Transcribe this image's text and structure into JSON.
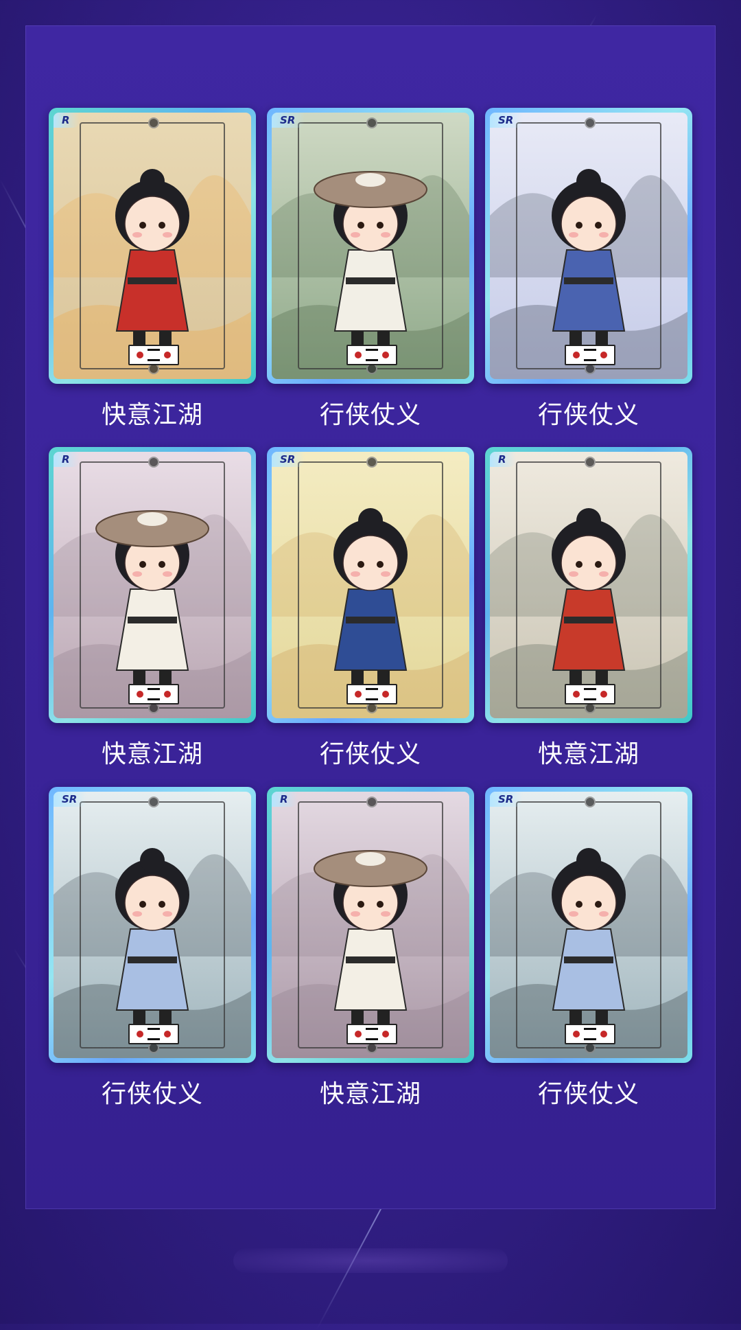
{
  "cards": [
    {
      "rarity": "R",
      "caption": "快意江湖",
      "bg": [
        "#e9d9b4",
        "#d9c49a"
      ],
      "outfit": "#c8302a",
      "hat": false,
      "accent": "#f2a23a"
    },
    {
      "rarity": "SR",
      "caption": "行侠仗义",
      "bg": [
        "#cfd9c4",
        "#8fa98a"
      ],
      "outfit": "#f2efe6",
      "hat": true,
      "accent": "#3f5a3a"
    },
    {
      "rarity": "SR",
      "caption": "行侠仗义",
      "bg": [
        "#e8eaf6",
        "#c5cbe8"
      ],
      "outfit": "#4a63b0",
      "hat": false,
      "accent": "#2b3340"
    },
    {
      "rarity": "R",
      "caption": "快意江湖",
      "bg": [
        "#e9dde6",
        "#b9a6b2"
      ],
      "outfit": "#f3efe5",
      "hat": true,
      "accent": "#8a7784"
    },
    {
      "rarity": "SR",
      "caption": "行侠仗义",
      "bg": [
        "#f4ecc2",
        "#e3d79a"
      ],
      "outfit": "#2f4d95",
      "hat": false,
      "accent": "#c9954a"
    },
    {
      "rarity": "R",
      "caption": "快意江湖",
      "bg": [
        "#efeadf",
        "#c9c4b4"
      ],
      "outfit": "#c83a2a",
      "hat": false,
      "accent": "#4c5a4c"
    },
    {
      "rarity": "SR",
      "caption": "行侠仗义",
      "bg": [
        "#e6eef0",
        "#9fb4bc"
      ],
      "outfit": "#a9bfe3",
      "hat": false,
      "accent": "#1f2a30"
    },
    {
      "rarity": "R",
      "caption": "快意江湖",
      "bg": [
        "#e4d9e2",
        "#aa98a6"
      ],
      "outfit": "#f3efe5",
      "hat": true,
      "accent": "#8a7784"
    },
    {
      "rarity": "SR",
      "caption": "行侠仗义",
      "bg": [
        "#e6eef0",
        "#9fb4bc"
      ],
      "outfit": "#a9bfe3",
      "hat": false,
      "accent": "#1f2a30"
    }
  ]
}
